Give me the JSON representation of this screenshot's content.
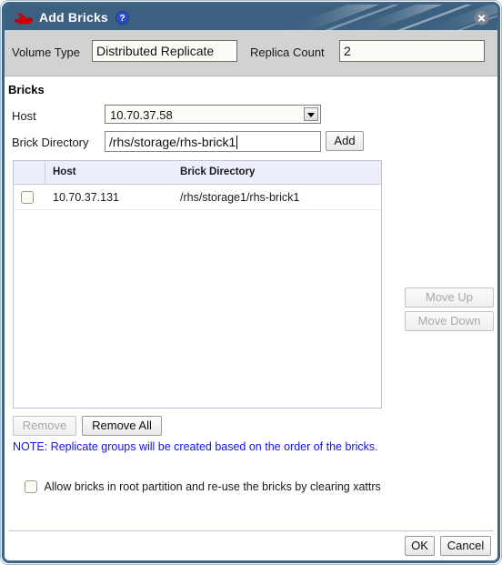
{
  "window": {
    "title": "Add Bricks",
    "logo_icon": "red-hat-shadowman-logo",
    "help_icon": "?",
    "close_icon": "close-x-icon"
  },
  "form": {
    "volume_type_label": "Volume Type",
    "volume_type_value": "Distributed Replicate",
    "replica_count_label": "Replica Count",
    "replica_count_value": "2"
  },
  "bricks": {
    "section_title": "Bricks",
    "host_label": "Host",
    "host_value": "10.70.37.58",
    "brick_dir_label": "Brick Directory",
    "brick_dir_value": "/rhs/storage/rhs-brick1",
    "add_label": "Add"
  },
  "table": {
    "columns": [
      "",
      "Host",
      "Brick Directory"
    ],
    "rows": [
      {
        "checked": false,
        "host": "10.70.37.131",
        "directory": "/rhs/storage1/rhs-brick1"
      }
    ]
  },
  "side_buttons": {
    "move_up": "Move Up",
    "move_down": "Move Down"
  },
  "actions": {
    "remove": "Remove",
    "remove_all": "Remove All"
  },
  "note": "NOTE: Replicate groups will be created based on the order of the bricks.",
  "options": {
    "allow_root_partition_label": "Allow bricks in root partition and re-use the bricks by clearing xattrs",
    "allow_root_partition_checked": false
  },
  "footer": {
    "ok": "OK",
    "cancel": "Cancel"
  },
  "colors": {
    "titlebar": "#3c6080",
    "border": "#3f6484",
    "form_strip": "#d2d2d2",
    "table_header": "#eceefa",
    "note_text": "#1414e0",
    "logo_red": "#cc0000",
    "help_blue": "#2a4fbf"
  }
}
